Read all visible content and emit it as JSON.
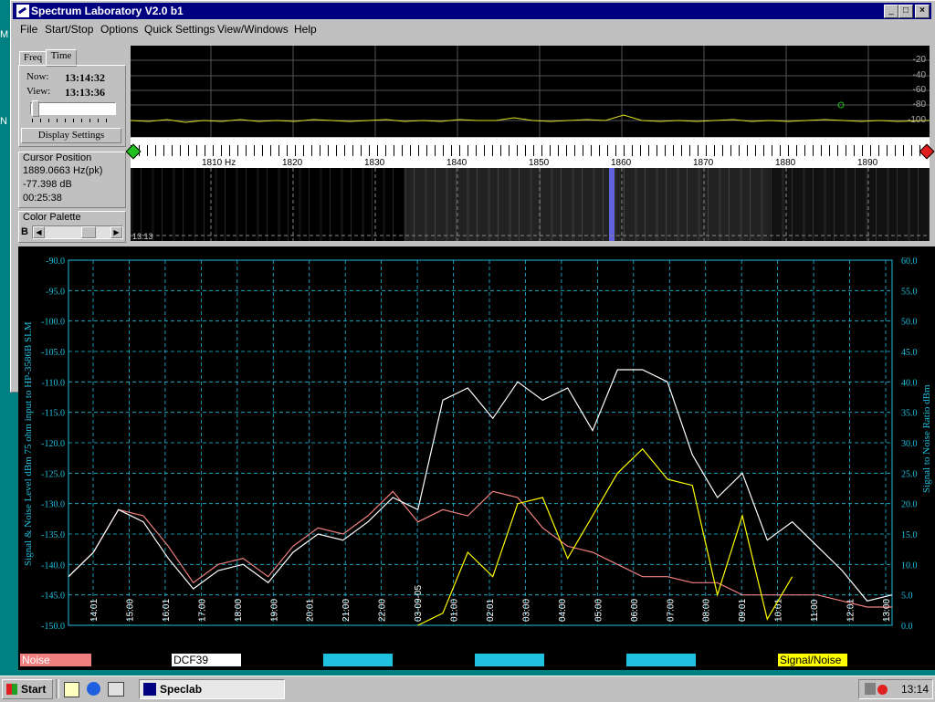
{
  "window": {
    "title": "Spectrum Laboratory V2.0 b1",
    "caption_buttons": [
      "minimize",
      "maximize",
      "close"
    ]
  },
  "menu": [
    "File",
    "Start/Stop",
    "Options",
    "Quick Settings",
    "View/Windows",
    "Help"
  ],
  "panel": {
    "tabs": [
      "Freq",
      "Time"
    ],
    "now_label": "Now:",
    "now_value": "13:14:32",
    "view_label": "View:",
    "view_value": "13:13:36",
    "display_settings": "Display Settings",
    "cursor_title": "Cursor Position",
    "cursor_freq": "1889.0663 Hz(pk)",
    "cursor_level": "-77.398 dB",
    "cursor_time": "00:25:38",
    "palette_title": "Color Palette",
    "palette_b": "B"
  },
  "spectrum": {
    "db_labels": [
      "-20",
      "-40",
      "-60",
      "-80",
      "-100"
    ],
    "freq_labels": [
      "1810 Hz",
      "1820",
      "1830",
      "1840",
      "1850",
      "1860",
      "1870",
      "1880",
      "1890"
    ],
    "waterfall_time": "13:13"
  },
  "chart_data": {
    "type": "line",
    "ylabel": "Signal & Noise Level dBm 75 ohm input to HP-3586B SLM",
    "y2label": "Signal to Noise Ratio     dBm",
    "ylim": [
      -150,
      -90
    ],
    "y2lim": [
      0,
      60
    ],
    "yticks": [
      "-90.0",
      "-95.0",
      "-100.0",
      "-105.0",
      "-110.0",
      "-115.0",
      "-120.0",
      "-125.0",
      "-130.0",
      "-135.0",
      "-140.0",
      "-145.0",
      "-150.0"
    ],
    "y2ticks": [
      "60.0",
      "55.0",
      "50.0",
      "45.0",
      "40.0",
      "35.0",
      "30.0",
      "25.0",
      "20.0",
      "15.0",
      "10.0",
      "5.0",
      "0.0"
    ],
    "xticks": [
      "14:01",
      "15:00",
      "16:01",
      "17:00",
      "18:00",
      "19:00",
      "20:01",
      "21:00",
      "22:00",
      "03-09-05",
      "01:00",
      "02:01",
      "03:00",
      "04:00",
      "05:00",
      "06:00",
      "07:00",
      "08:00",
      "09:01",
      "10:01",
      "11:00",
      "12:01",
      "13:00"
    ],
    "grid": true,
    "series": [
      {
        "name": "Noise",
        "color": "#f08080",
        "values": [
          -142,
          -138,
          -131,
          -132,
          -137,
          -143,
          -140,
          -139,
          -142,
          -137,
          -134,
          -135,
          -132,
          -128,
          -133,
          -131,
          -132,
          -128,
          -129,
          -134,
          -137,
          -138,
          -140,
          -142,
          -142,
          -143,
          -143,
          -145,
          -145,
          -145,
          -145,
          -146,
          -147,
          -147
        ]
      },
      {
        "name": "DCF39",
        "color": "#ffffff",
        "values": [
          -142,
          -138,
          -131,
          -133,
          -139,
          -144,
          -141,
          -140,
          -143,
          -138,
          -135,
          -136,
          -133,
          -129,
          -131,
          -113,
          -111,
          -116,
          -110,
          -113,
          -111,
          -118,
          -108,
          -108,
          -110,
          -122,
          -129,
          -125,
          -136,
          -133,
          -137,
          -141,
          -146,
          -145
        ]
      },
      {
        "name": "Signal/Noise",
        "color": "#ffff00",
        "values": [
          null,
          null,
          null,
          null,
          null,
          null,
          null,
          null,
          null,
          null,
          null,
          null,
          null,
          null,
          0,
          2,
          12,
          8,
          20,
          21,
          11,
          18,
          25,
          29,
          24,
          23,
          5,
          18,
          1,
          8,
          null,
          null,
          null,
          null
        ]
      }
    ]
  },
  "legend": [
    {
      "label": "Noise",
      "color": "#f08080",
      "text_color": "#ffffff"
    },
    {
      "label": "DCF39",
      "color": "#ffffff",
      "text_color": "#000000"
    },
    {
      "label": "",
      "color": "#20c0e0",
      "text_color": "#000000"
    },
    {
      "label": "",
      "color": "#20c0e0",
      "text_color": "#000000"
    },
    {
      "label": "",
      "color": "#20c0e0",
      "text_color": "#000000"
    },
    {
      "label": "Signal/Noise",
      "color": "#ffff00",
      "text_color": "#000000"
    }
  ],
  "taskbar": {
    "start": "Start",
    "task": "Speclab",
    "clock": "13:14"
  }
}
